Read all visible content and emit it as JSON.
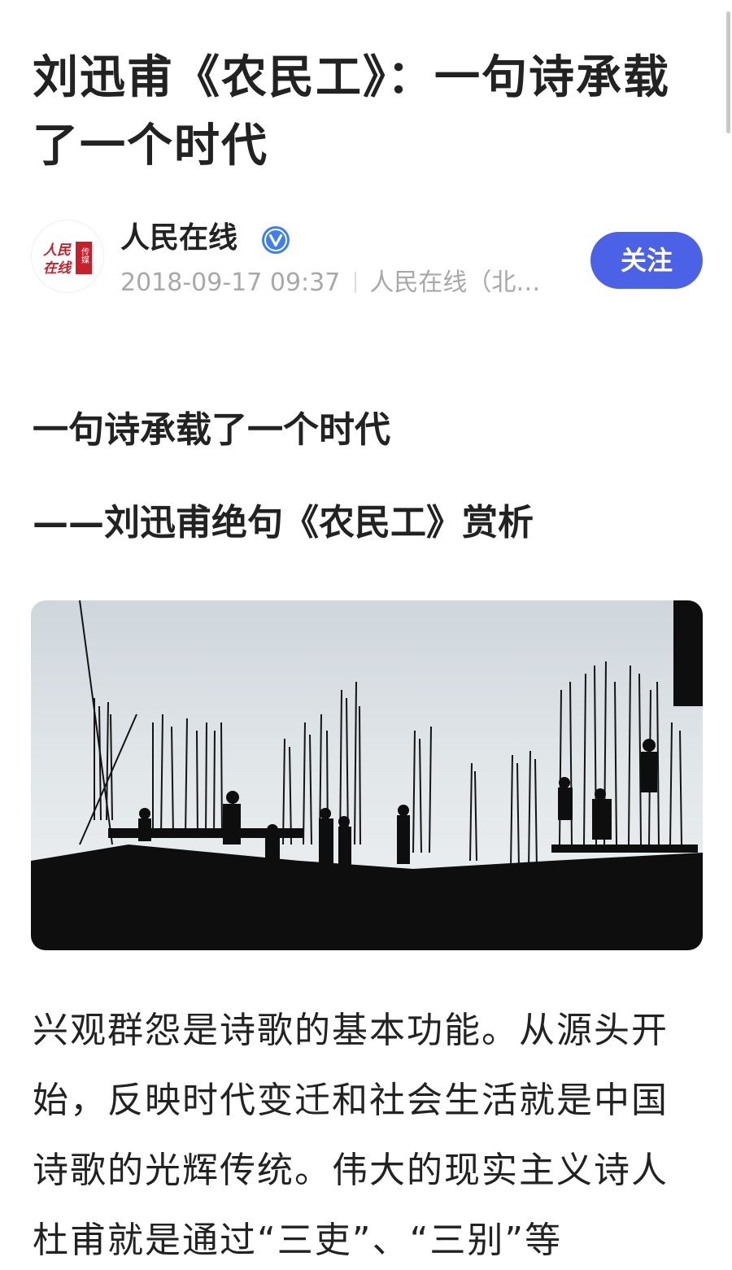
{
  "article": {
    "title": "刘迅甫《农民工》：一句诗承载了一个时代",
    "subtitle": "一句诗承载了一个时代",
    "subheading": "——刘迅甫绝句《农民工》赏析",
    "body_text": "兴观群怨是诗歌的基本功能。从源头开始，反映时代变迁和社会生活就是中国诗歌的光辉传统。伟大的现实主义诗人杜甫就是通过“三吏”、“三别”等"
  },
  "author": {
    "name": "人民在线",
    "verified_icon": "verified-check-icon",
    "date": "2018-09-17 09:37",
    "source": "人民在线（北…",
    "avatar_text": [
      "人民",
      "在线",
      "传媒"
    ],
    "follow_label": "关注"
  },
  "photo": {
    "icon": "construction-workers-silhouette-image"
  },
  "colors": {
    "accent": "#4c62e6",
    "verified": "#3d7ff2",
    "avatar_red": "#c8202a",
    "meta_gray": "#a8a8a8"
  }
}
